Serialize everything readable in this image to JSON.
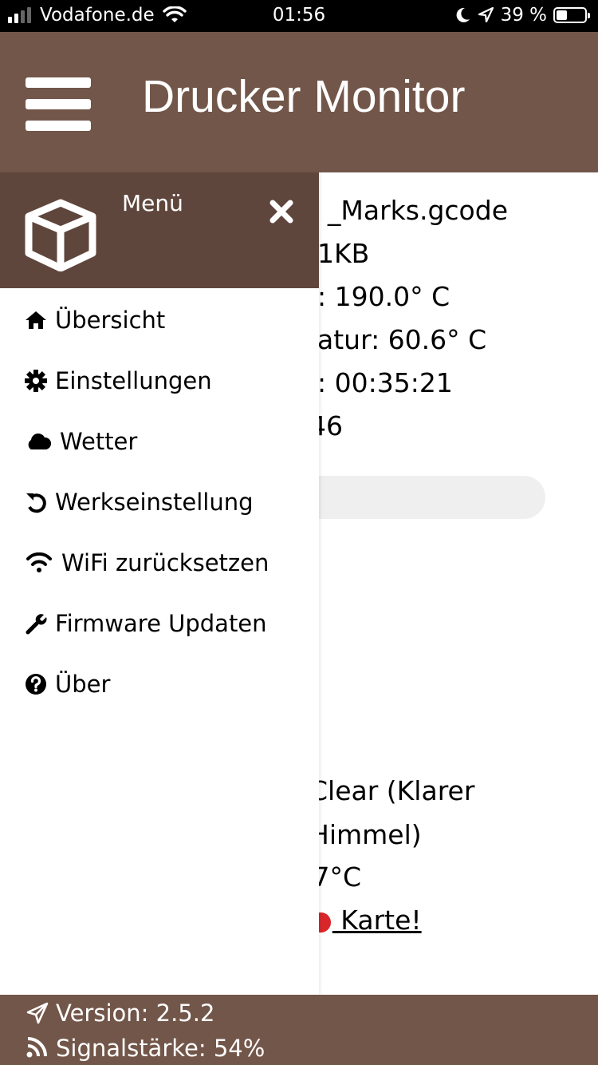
{
  "status_bar": {
    "carrier": "Vodafone.de",
    "time": "01:56",
    "battery_percent": "39 %",
    "battery_level": 0.39,
    "icons": [
      "signal-icon",
      "wifi-icon",
      "moon-icon",
      "location-arrow-icon",
      "battery-icon"
    ]
  },
  "header": {
    "title": "Drucker Monitor",
    "menu_icon": "hamburger-icon",
    "color": "#725649"
  },
  "drawer": {
    "title": "Menü",
    "logo_icon": "cube-icon",
    "close_icon": "close-icon",
    "header_color": "#5f463c",
    "items": [
      {
        "label": "Übersicht",
        "icon": "home-icon"
      },
      {
        "label": "Einstellungen",
        "icon": "gear-icon"
      },
      {
        "label": "Wetter",
        "icon": "cloud-icon"
      },
      {
        "label": "Werkseinstellung",
        "icon": "undo-icon"
      },
      {
        "label": "WiFi zurücksetzen",
        "icon": "wifi-icon"
      },
      {
        "label": "Firmware Updaten",
        "icon": "wrench-icon"
      },
      {
        "label": "Über",
        "icon": "question-circle-icon"
      }
    ]
  },
  "background_content": {
    "file_line": "_Marks.gcode",
    "size_line": "1KB",
    "tool_temp_line": ": 190.0° C",
    "bed_temp_line": "atur: 60.6° C",
    "time_line": ": 00:35:21",
    "number_line": "46",
    "weather_line_1": "Clear (Klarer",
    "weather_line_2": "Himmel)",
    "temp_line": ".7°C",
    "map_link": " Karte!",
    "map_link_icon": "map-pin-icon"
  },
  "footer": {
    "version": "Version: 2.5.2",
    "signal": "Signalstärke: 54%",
    "version_icon": "paper-plane-icon",
    "signal_icon": "rss-icon",
    "color": "#725649"
  }
}
